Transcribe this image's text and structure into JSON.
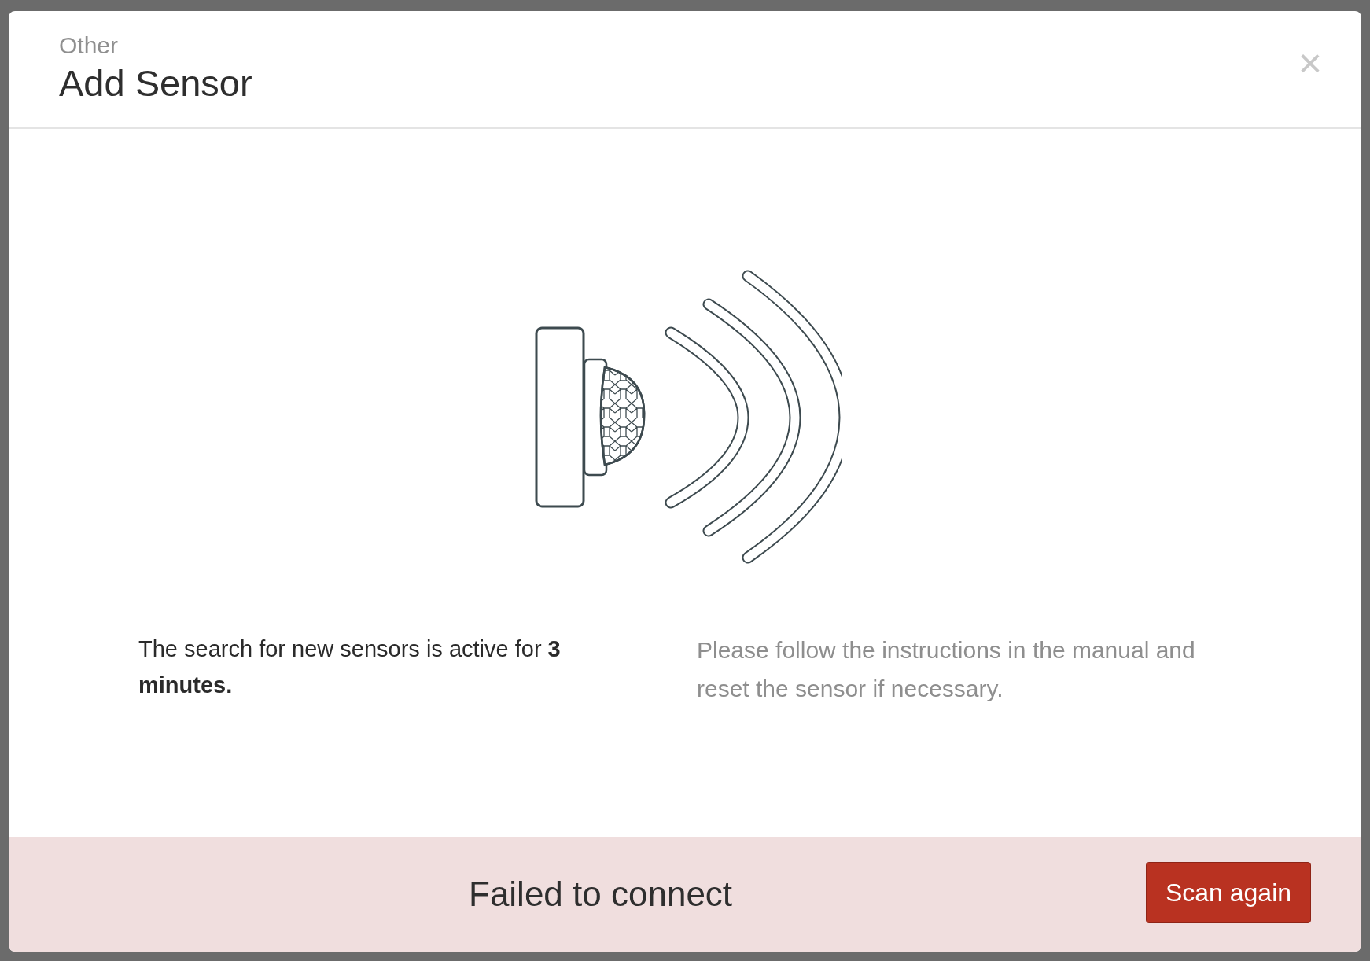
{
  "dialog": {
    "category": "Other",
    "title": "Add Sensor",
    "close_label": "×"
  },
  "info": {
    "left": "The search for new sensors is active for **3 minutes.**",
    "right": "Please follow the instructions in the manual and reset the sensor if necessary."
  },
  "status": {
    "message": "Failed to connect",
    "button": "Scan again"
  }
}
